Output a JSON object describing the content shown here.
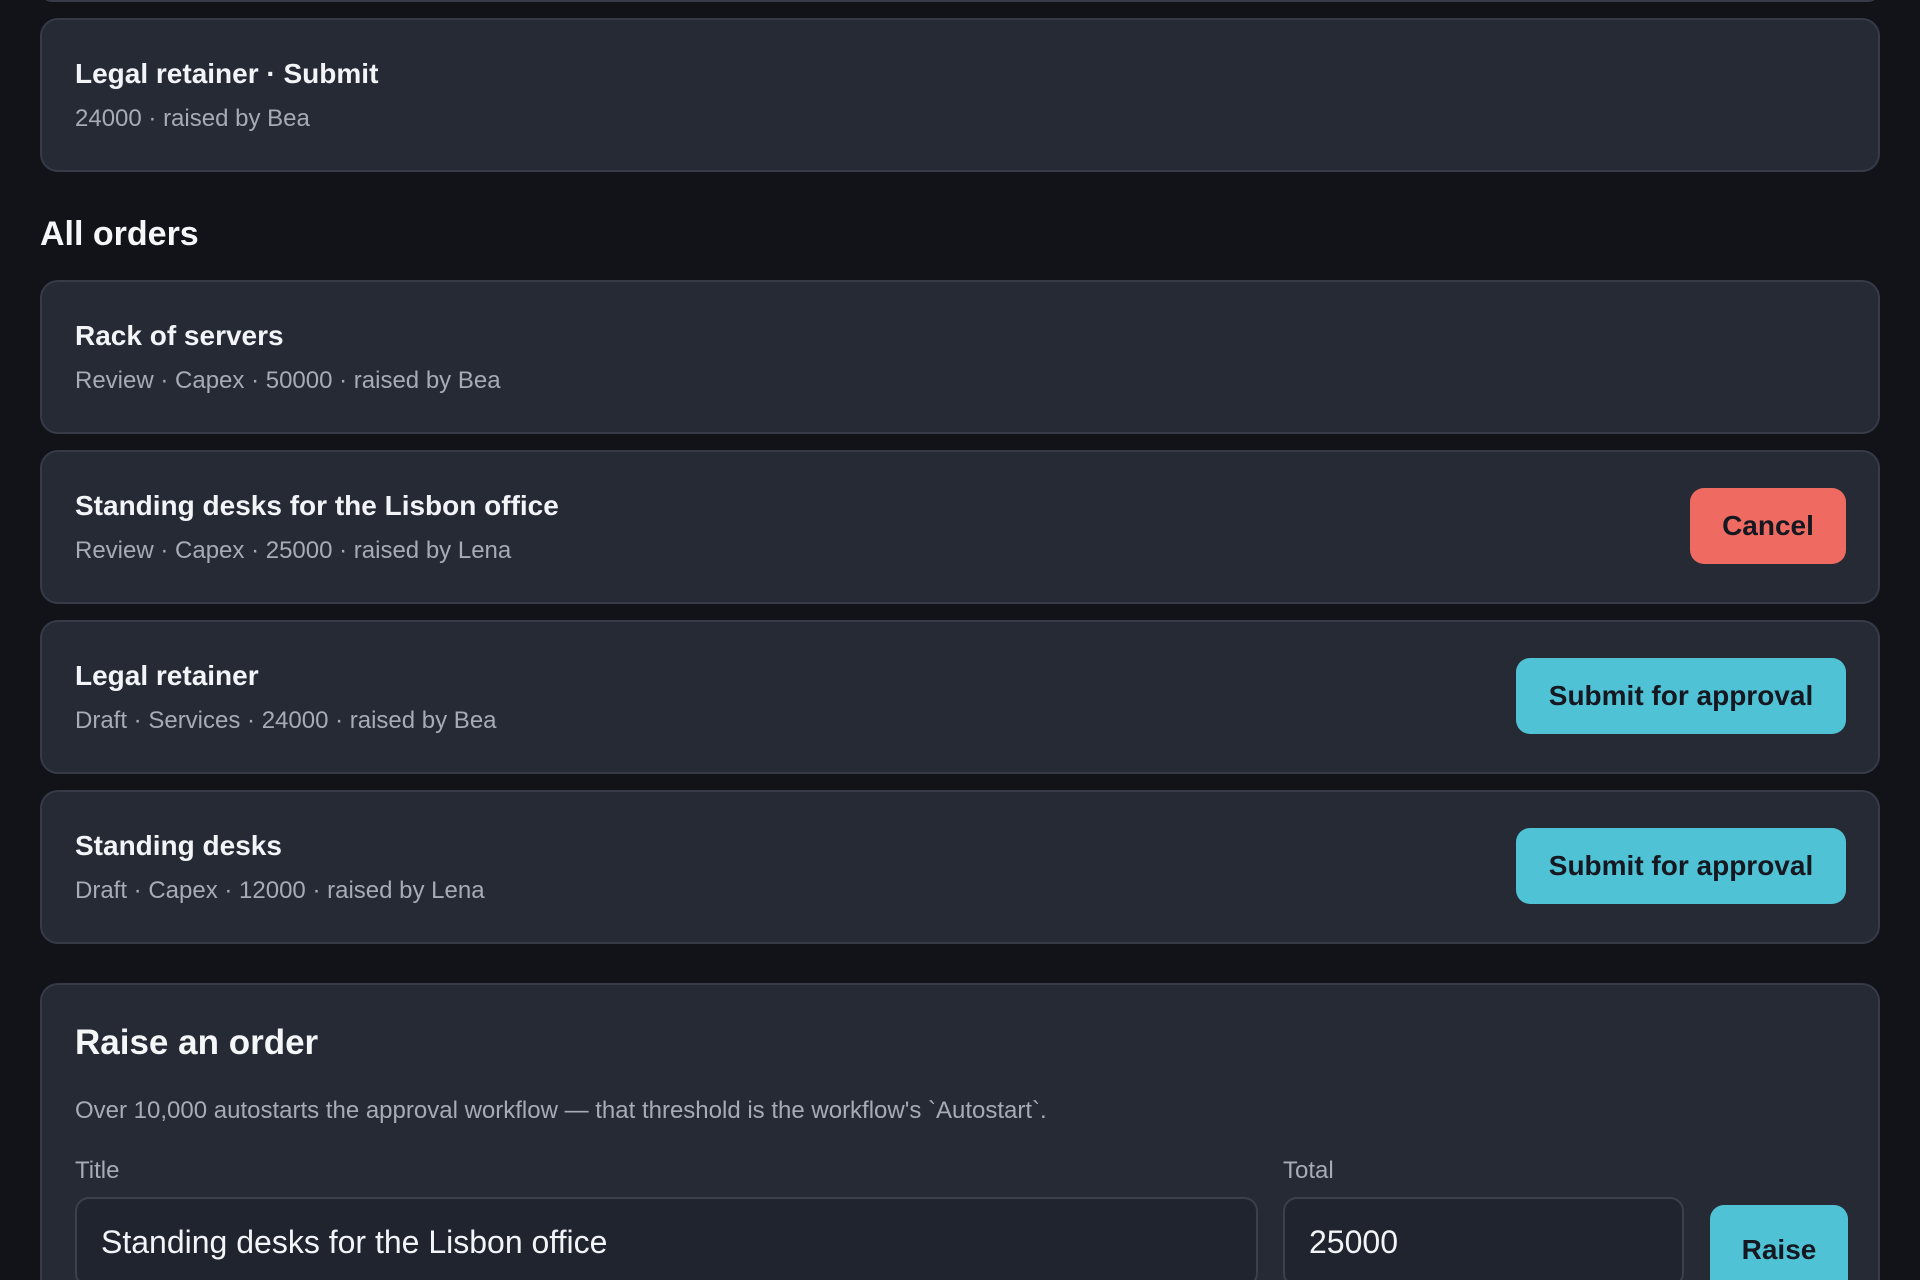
{
  "summary_card": {
    "title": "Legal retainer · Submit",
    "meta": "24000 · raised by Bea"
  },
  "all_orders": {
    "heading": "All orders",
    "orders": [
      {
        "title": "Rack of servers",
        "meta": "Review · Capex · 50000 · raised by Bea",
        "action": ""
      },
      {
        "title": "Standing desks for the Lisbon office",
        "meta": "Review · Capex · 25000 · raised by Lena",
        "action": "Cancel"
      },
      {
        "title": "Legal retainer",
        "meta": "Draft · Services · 24000 · raised by Bea",
        "action": "Submit for approval"
      },
      {
        "title": "Standing desks",
        "meta": "Draft · Capex · 12000 · raised by Lena",
        "action": "Submit for approval"
      }
    ]
  },
  "raise_form": {
    "heading": "Raise an order",
    "description": "Over 10,000 autostarts the approval workflow — that threshold is the workflow's `Autostart`.",
    "title_label": "Title",
    "title_value": "Standing desks for the Lisbon office",
    "total_label": "Total",
    "total_value": "25000",
    "submit_label": "Raise"
  },
  "colors": {
    "background": "#111318",
    "card": "#262a35",
    "cancel_button": "#ef6b62",
    "primary_button": "#4fc3d5"
  }
}
